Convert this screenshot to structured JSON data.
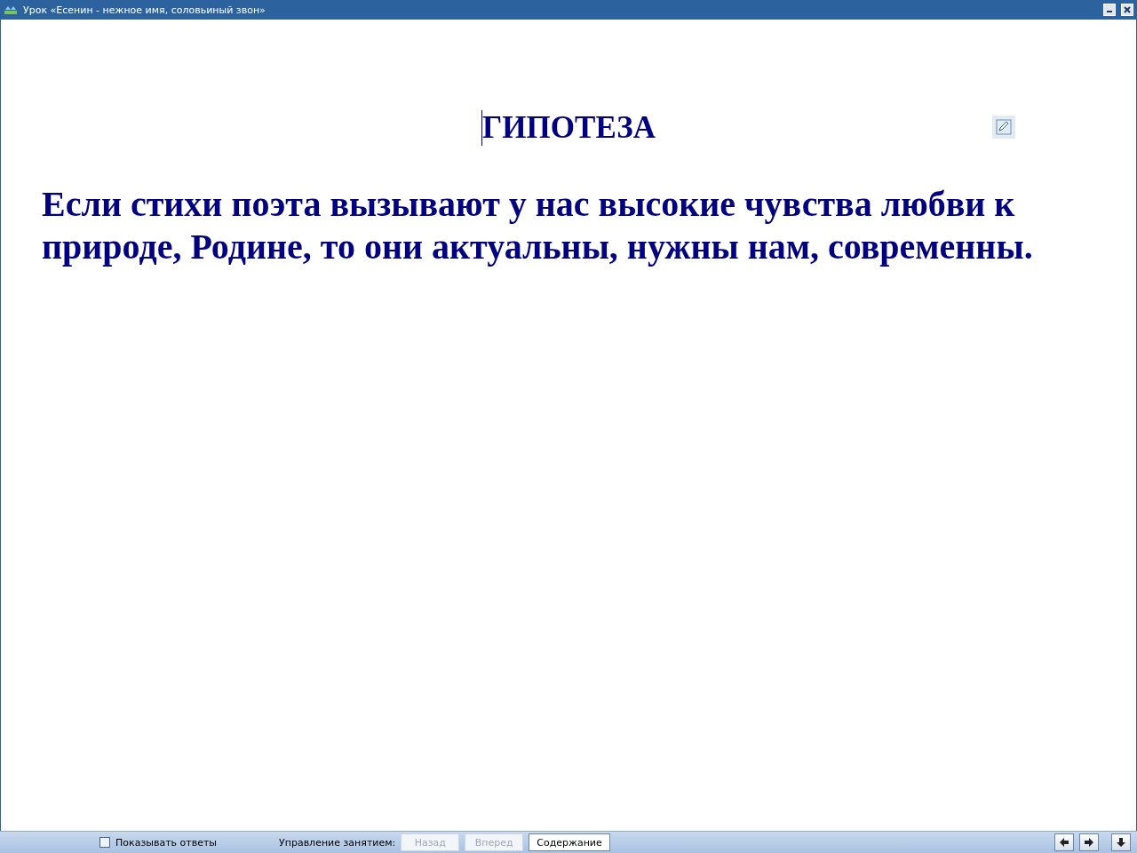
{
  "window": {
    "title": "Урок «Есенин - нежное имя, соловьиный звон»"
  },
  "slide": {
    "heading": "ГИПОТЕЗА",
    "text": "Если стихи поэта вызывают у нас высокие чувства любви к природе, Родине, то они актуальны, нужны нам, современны."
  },
  "bottom_bar": {
    "show_answers": {
      "label": "Показывать ответы",
      "checked": false
    },
    "control_label": "Управление занятием:",
    "buttons": [
      {
        "label": "Назад",
        "disabled": true
      },
      {
        "label": "Вперед",
        "disabled": true
      },
      {
        "label": "Содержание",
        "disabled": false
      }
    ]
  }
}
